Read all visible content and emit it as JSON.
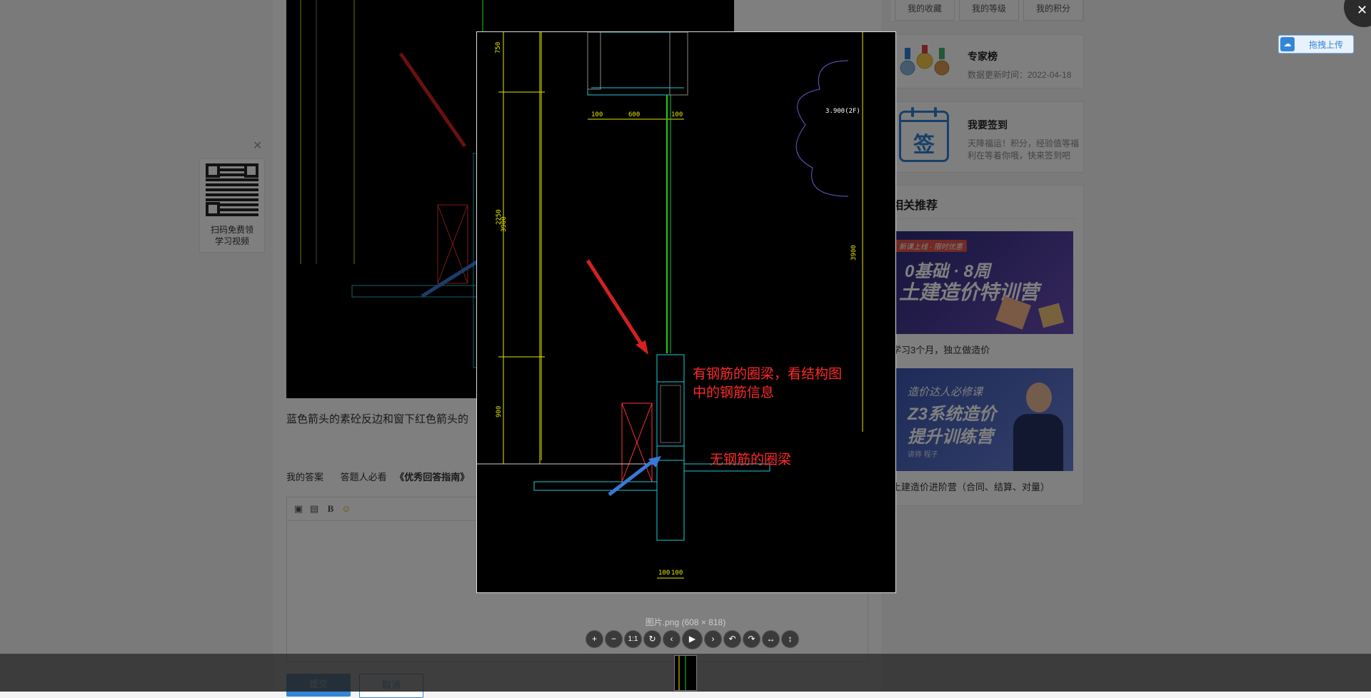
{
  "sidebar": {
    "tabs": [
      "我的收藏",
      "我的等级",
      "我的积分"
    ],
    "rank": {
      "title": "专家榜",
      "updated": "数据更新时间：2022-04-18"
    },
    "signin": {
      "icon_char": "签",
      "title": "我要签到",
      "desc_line1": "天降福运！积分，经验值等福",
      "desc_line2": "利在等着你哦，快来签到吧"
    },
    "recommend": {
      "title": "相关推荐",
      "items": [
        {
          "caption": "学习3个月，独立做造价",
          "tag": "新课上线 · 限时优惠",
          "line1": "0基础 · 8周",
          "line2": "土建造价特训营"
        },
        {
          "caption": "土建造价进阶营（合同、结算、对量）",
          "line0": "造价达人必修课",
          "line1": "Z3系统造价",
          "line2": "提升训练营",
          "lecturer": "讲师 程子"
        }
      ]
    }
  },
  "main": {
    "question_text": "蓝色箭头的素砼反边和窗下红色箭头的",
    "tabs": [
      "我的答案",
      "答题人必看",
      "《优秀回答指南》"
    ],
    "toolbar": {
      "bold": "B"
    },
    "submit_label": "提交",
    "cancel_label": "取消"
  },
  "qr": {
    "line1": "扫码免费领",
    "line2": "学习视频"
  },
  "upload": {
    "label": "拖拽上传"
  },
  "viewer": {
    "caption": "图片.png (608 × 818)",
    "annotation1_line1": "有钢筋的圈梁，看结构图",
    "annotation1_line2": "中的钢筋信息",
    "annotation2": "无钢筋的圈梁",
    "dims": {
      "d100a": "100",
      "d600": "600",
      "d100b": "100",
      "d2250": "2250",
      "d3900": "3900",
      "d900": "900",
      "d750": "750",
      "elev": "3.900(2F)",
      "d100c": "100",
      "d100d": "100"
    },
    "controls": [
      "+",
      "−",
      "1:1",
      "↻",
      "‹",
      "▶",
      "›",
      "↶",
      "↷",
      "↔",
      "↕"
    ]
  },
  "colors": {
    "accent": "#3386d7",
    "annotation": "#ff2a2a",
    "cad_cyan": "#1fc8d8",
    "cad_yellow": "#e6e600",
    "cad_green": "#22cc22"
  }
}
